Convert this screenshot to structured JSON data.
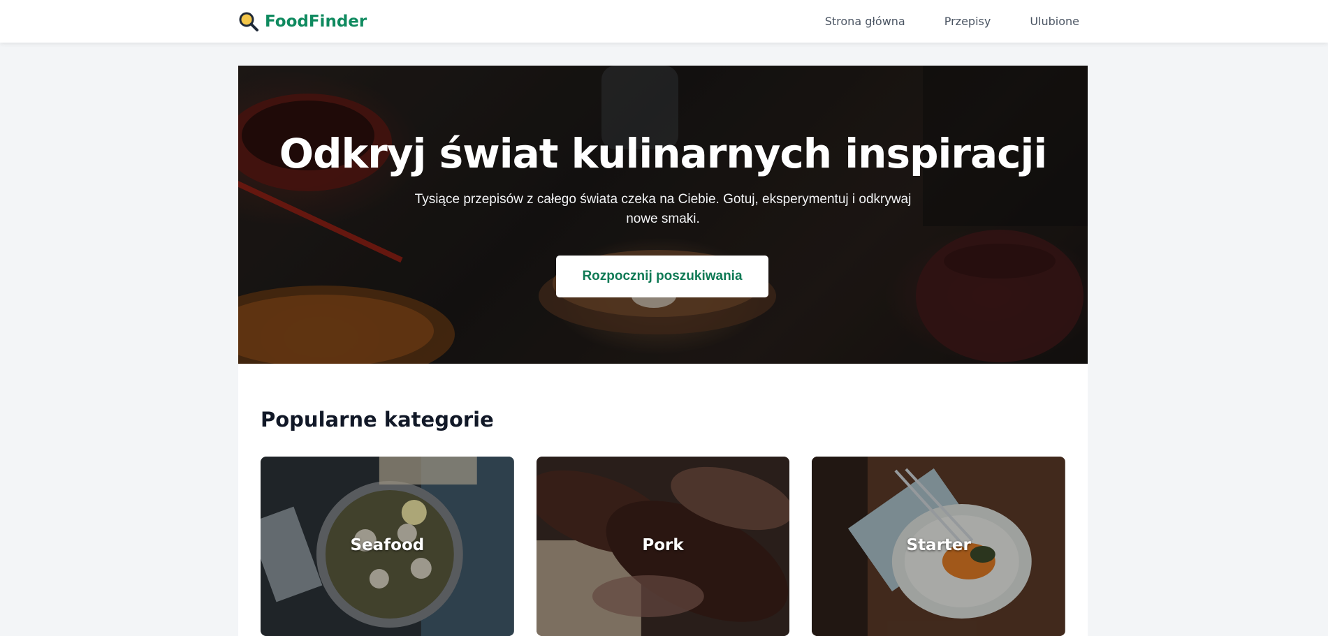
{
  "header": {
    "brand": "FoodFinder",
    "brand_color": "#0f8a5f",
    "logo_icon": "magnifier-icon",
    "nav": [
      {
        "label": "Strona główna"
      },
      {
        "label": "Przepisy"
      },
      {
        "label": "Ulubione"
      }
    ]
  },
  "hero": {
    "title": "Odkryj świat kulinarnych inspiracji",
    "subtitle": "Tysiące przepisów z całego świata czeka na Ciebie. Gotuj, eksperymentuj i odkrywaj nowe smaki.",
    "button_label": "Rozpocznij poszukiwania"
  },
  "categories": {
    "title": "Popularne kategorie",
    "items": [
      {
        "label": "Seafood"
      },
      {
        "label": "Pork"
      },
      {
        "label": "Starter"
      }
    ]
  }
}
